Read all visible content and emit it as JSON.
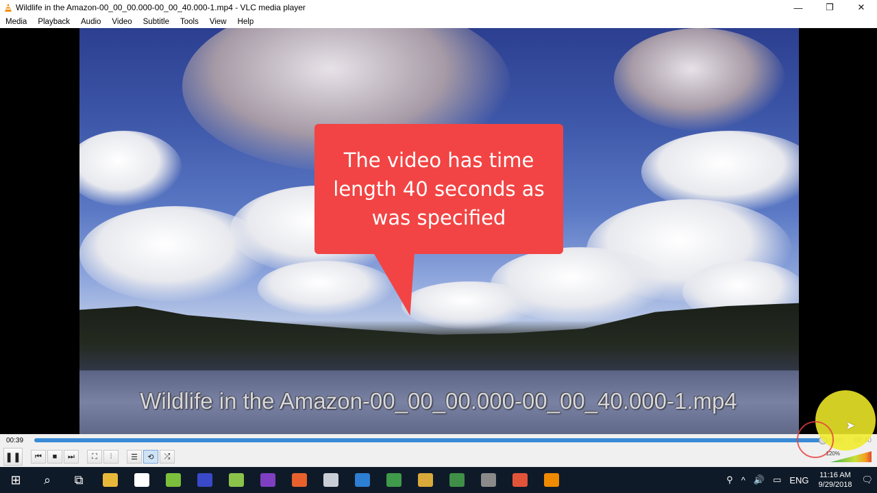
{
  "window": {
    "title": "Wildlife in the Amazon-00_00_00.000-00_00_40.000-1.mp4 - VLC media player",
    "minimize": "—",
    "restore": "❐",
    "close": "✕"
  },
  "menu": [
    "Media",
    "Playback",
    "Audio",
    "Video",
    "Subtitle",
    "Tools",
    "View",
    "Help"
  ],
  "video": {
    "callout": "The video has time length 40 seconds as was specified",
    "subtitle": "Wildlife in the Amazon-00_00_00.000-00_00_40.000-1.mp4"
  },
  "seek": {
    "elapsed": "00:39",
    "total": "00:40",
    "progress_fraction": 0.975
  },
  "controls": {
    "pause": "❚❚",
    "prev": "⏮",
    "stop": "■",
    "next": "⏭",
    "fullscreen": "⛶",
    "extended": "⫶",
    "playlist": "☰",
    "loop": "⟲",
    "shuffle": "⤮",
    "volume_label": "120%",
    "volume_level": 1.2
  },
  "taskbar": {
    "start": "⊞",
    "search": "⌕",
    "taskview": "⧉",
    "apps": [
      {
        "name": "file-explorer-icon",
        "color": "#e8b83a"
      },
      {
        "name": "camera-icon",
        "color": "#ffffff"
      },
      {
        "name": "editor-icon",
        "color": "#7cbf3c"
      },
      {
        "name": "save-disk-icon",
        "color": "#3a49c9"
      },
      {
        "name": "notepad-icon",
        "color": "#8bc34a"
      },
      {
        "name": "visual-studio-icon",
        "color": "#7e3fc2"
      },
      {
        "name": "firefox-icon",
        "color": "#e8612c"
      },
      {
        "name": "files-icon",
        "color": "#c9ced6"
      },
      {
        "name": "browser-icon",
        "color": "#2d7fd3"
      },
      {
        "name": "checklist-icon",
        "color": "#3f9a4a"
      },
      {
        "name": "tools-icon",
        "color": "#d9a93a"
      },
      {
        "name": "spreadsheet-icon",
        "color": "#3f8f47"
      },
      {
        "name": "film-icon",
        "color": "#8a8a8a"
      },
      {
        "name": "camtasia-icon",
        "color": "#e2543a"
      },
      {
        "name": "vlc-icon",
        "color": "#f08a00"
      }
    ],
    "tray": {
      "people": "⚲",
      "chevron": "^",
      "sound": "🔊",
      "battery": "▭",
      "language": "ENG",
      "time": "11:16 AM",
      "date": "9/29/2018",
      "notification": "🗨"
    }
  }
}
